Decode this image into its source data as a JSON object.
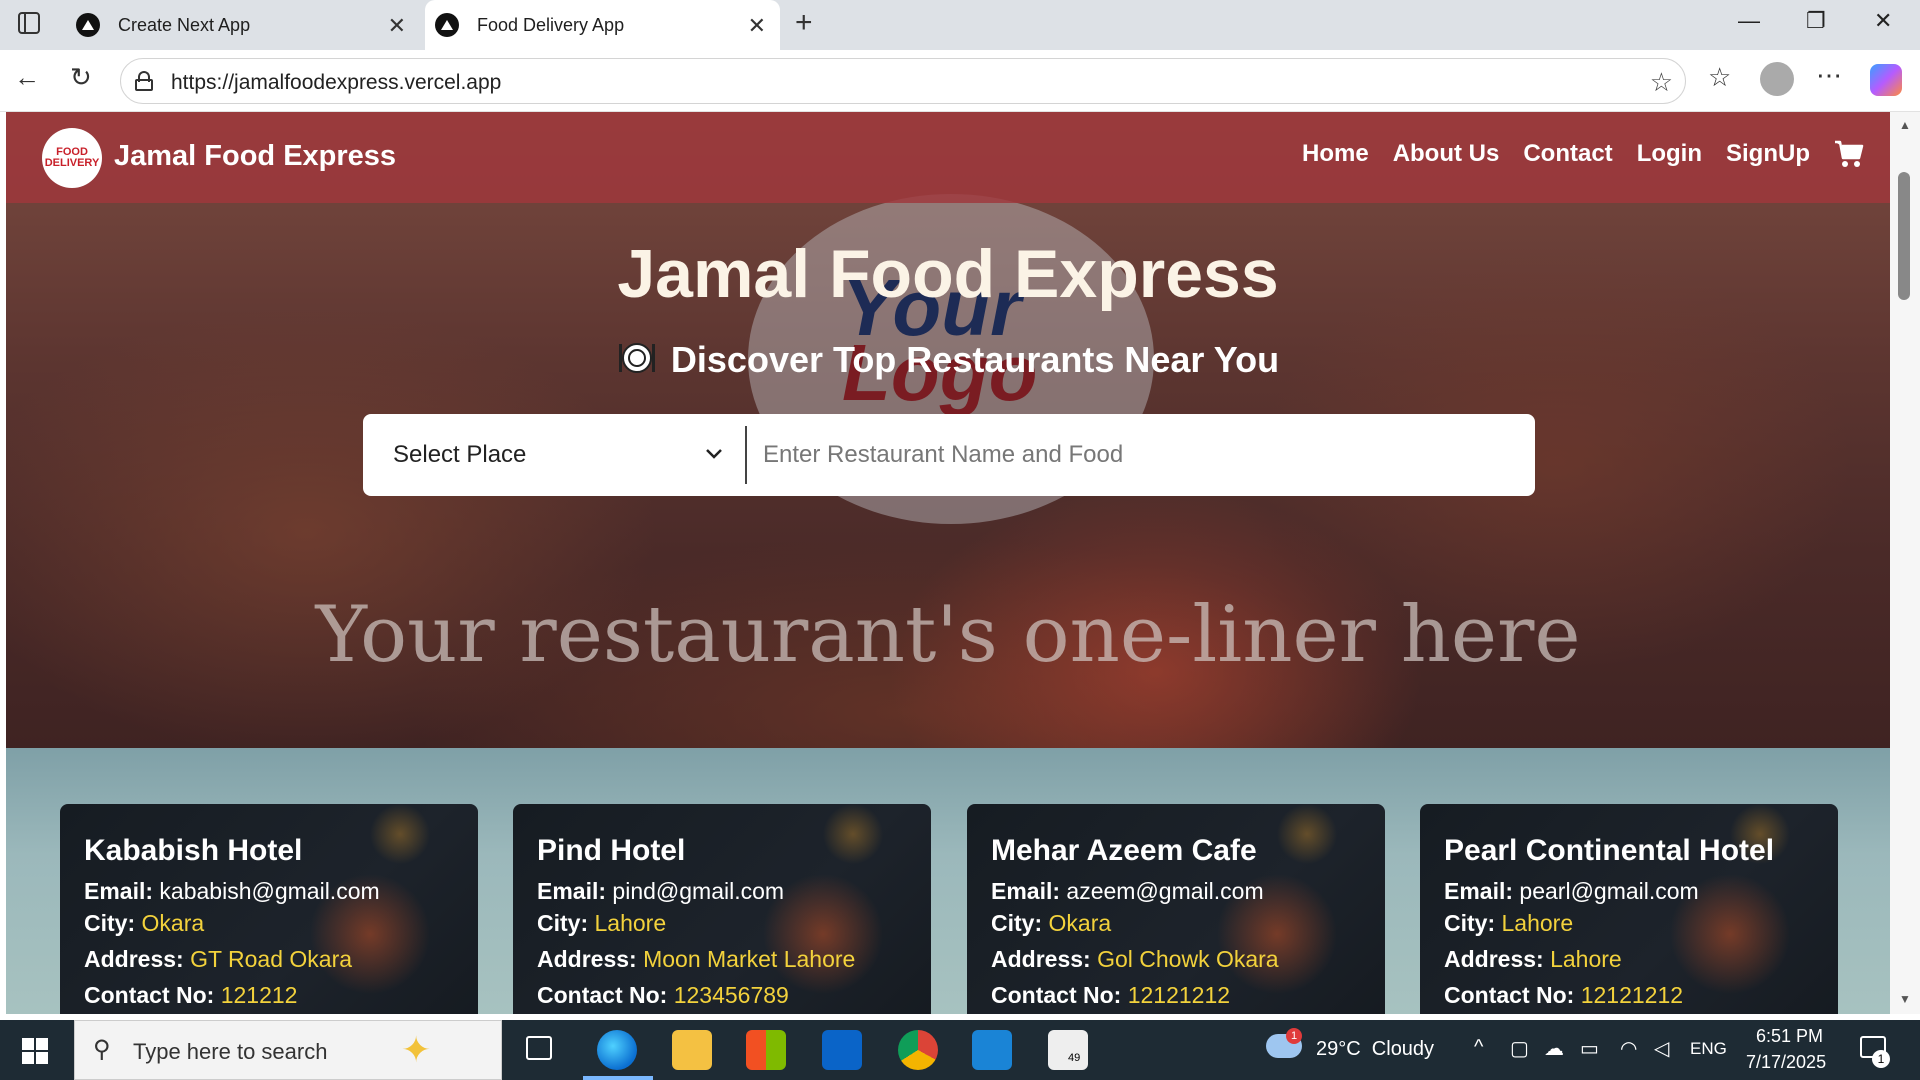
{
  "browser": {
    "tabs": [
      {
        "label": "Create Next App"
      },
      {
        "label": "Food Delivery App"
      }
    ],
    "url": "https://jamalfoodexpress.vercel.app"
  },
  "site": {
    "logo_text": "FOOD DELIVERY",
    "brand": "Jamal Food Express",
    "nav": [
      "Home",
      "About Us",
      "Contact",
      "Login",
      "SignUp"
    ],
    "hero_title": "Jamal Food Express",
    "hero_subtitle": "Discover Top Restaurants Near You",
    "background_logo": {
      "line1": "Your",
      "line2": "Logo"
    },
    "select_place": "Select Place",
    "search_placeholder": "Enter Restaurant Name and Food",
    "one_liner": "Your restaurant's one-liner here",
    "labels": {
      "email": "Email:",
      "city": "City:",
      "address": "Address:",
      "contact": "Contact No:"
    },
    "restaurants": [
      {
        "name": "Kababish Hotel",
        "email": "kababish@gmail.com",
        "city": "Okara",
        "address": "GT Road Okara",
        "contact": "121212"
      },
      {
        "name": "Pind Hotel",
        "email": "pind@gmail.com",
        "city": "Lahore",
        "address": "Moon Market Lahore",
        "contact": "123456789"
      },
      {
        "name": "Mehar Azeem Cafe",
        "email": "azeem@gmail.com",
        "city": "Okara",
        "address": "Gol Chowk Okara",
        "contact": "12121212"
      },
      {
        "name": "Pearl Continental Hotel",
        "email": "pearl@gmail.com",
        "city": "Lahore",
        "address": "Lahore",
        "contact": "12121212"
      }
    ]
  },
  "taskbar": {
    "search_placeholder": "Type here to search",
    "weather": "29°C  Cloudy",
    "weather_badge": "1",
    "language": "ENG",
    "time": "6:51 PM",
    "date": "7/17/2025",
    "notif_count": "1",
    "task_badge": "49"
  },
  "colors": {
    "header": "#a0373c",
    "accent_yellow": "#f3d23c",
    "taskbar": "#1e2b34"
  }
}
